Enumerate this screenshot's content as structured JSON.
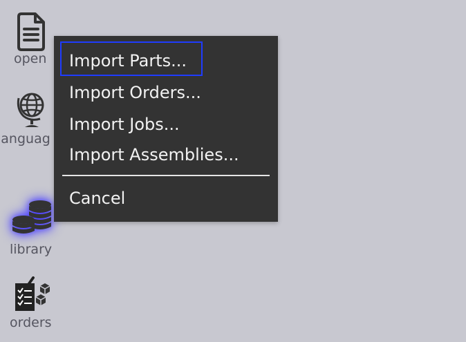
{
  "sidebar": {
    "items": [
      {
        "label": "open",
        "icon": "document-icon"
      },
      {
        "label": "languag",
        "icon": "globe-icon"
      },
      {
        "label": "library",
        "icon": "database-icon",
        "highlighted": true
      },
      {
        "label": "orders",
        "icon": "orders-clipboard-icon"
      }
    ]
  },
  "context_menu": {
    "items": [
      {
        "label": "Import Parts...",
        "focused": true
      },
      {
        "label": "Import Orders..."
      },
      {
        "label": "Import Jobs..."
      },
      {
        "label": "Import Assemblies..."
      }
    ],
    "cancel_label": "Cancel"
  },
  "colors": {
    "background": "#c8c8d0",
    "menu_background": "#333333",
    "menu_text": "#f2f2f2",
    "focus_ring": "#1f3cff",
    "icon": "#333333",
    "sidebar_label": "#555560",
    "glow": "#463cff"
  }
}
